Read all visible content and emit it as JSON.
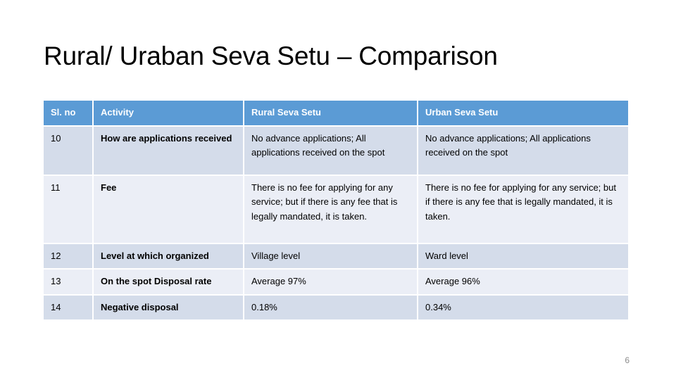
{
  "slide": {
    "title": "Rural/ Uraban Seva Setu – Comparison",
    "page_number": "6",
    "colors": {
      "header_fill": "#5b9bd5",
      "header_text": "#ffffff",
      "band_dark": "#d4dcea",
      "band_light": "#ebeef6",
      "body_text": "#000000",
      "page_number_text": "#8c8c8c",
      "background": "#ffffff"
    }
  },
  "table": {
    "columns": [
      {
        "key": "sl_no",
        "label": "Sl. no"
      },
      {
        "key": "activity",
        "label": "Activity"
      },
      {
        "key": "rural",
        "label": "Rural Seva Setu"
      },
      {
        "key": "urban",
        "label": "Urban Seva Setu"
      }
    ],
    "rows": [
      {
        "sl_no": "10",
        "activity": "How are applications received",
        "rural": "No advance applications; All applications received on the spot",
        "urban": "No advance applications; All applications received on the spot"
      },
      {
        "sl_no": "11",
        "activity": "Fee",
        "rural": "There is no fee for applying for any service; but if there is any fee that is legally mandated, it is taken.",
        "urban": "There is no fee for applying for any service; but if there is any fee that is legally mandated, it is taken."
      },
      {
        "sl_no": "12",
        "activity": "Level at which organized",
        "rural": "Village level",
        "urban": "Ward level"
      },
      {
        "sl_no": "13",
        "activity": "On the spot Disposal rate",
        "rural": "Average 97%",
        "urban": "Average 96%"
      },
      {
        "sl_no": "14",
        "activity": "Negative disposal",
        "rural": "0.18%",
        "urban": "0.34%"
      }
    ]
  }
}
